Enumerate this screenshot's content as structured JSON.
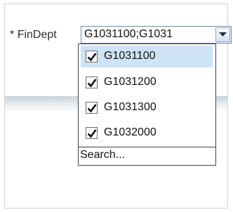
{
  "form": {
    "required_marker": "*",
    "label": "FinDept",
    "value": "G1031100;G1031"
  },
  "dropdown": {
    "options": [
      {
        "label": "G1031100",
        "checked": true,
        "highlighted": true
      },
      {
        "label": "G1031200",
        "checked": true,
        "highlighted": false
      },
      {
        "label": "G1031300",
        "checked": true,
        "highlighted": false
      },
      {
        "label": "G1032000",
        "checked": true,
        "highlighted": false
      }
    ],
    "search_label": "Search..."
  }
}
